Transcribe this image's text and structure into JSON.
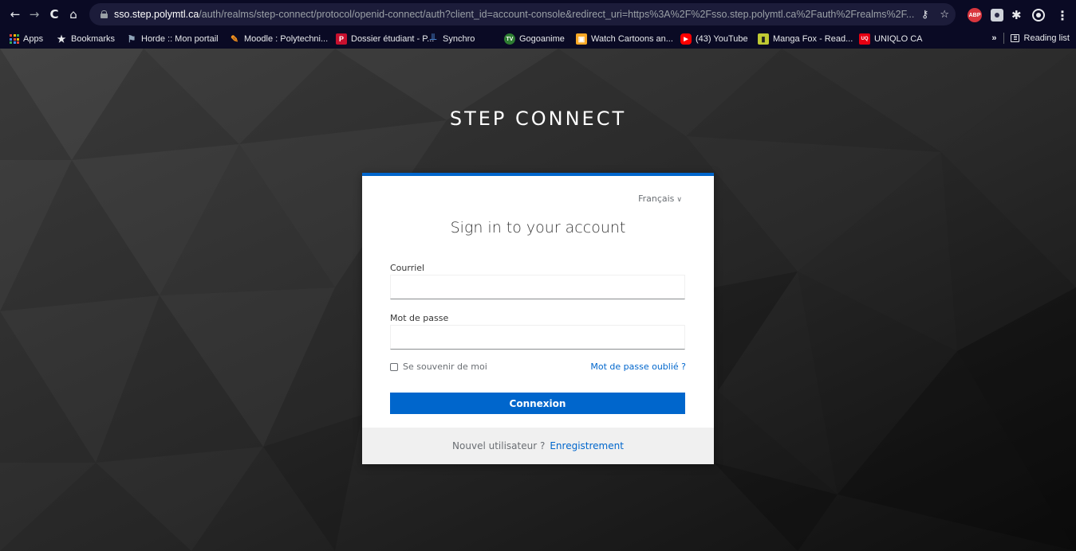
{
  "browser": {
    "url_host": "sso.step.polymtl.ca",
    "url_path": "/auth/realms/step-connect/protocol/openid-connect/auth?client_id=account-console&redirect_uri=https%3A%2F%2Fsso.step.polymtl.ca%2Fauth%2Frealms%2F...",
    "nav": {
      "back": "←",
      "forward": "→",
      "reload": "C",
      "home": "⌂"
    },
    "extensions": {
      "abp": "ABP"
    },
    "bookmarks": [
      {
        "label": "Apps",
        "icon": "apps-grid-icon"
      },
      {
        "label": "Bookmarks",
        "icon": "star-icon",
        "glyph": "★"
      },
      {
        "label": "Horde :: Mon portail",
        "icon": "horde-icon",
        "glyph": "⚑",
        "color": "#8fa3b8"
      },
      {
        "label": "Moodle : Polytechni...",
        "icon": "moodle-icon",
        "glyph": "✎",
        "color": "#f7931e"
      },
      {
        "label": "Dossier étudiant - P...",
        "icon": "polytechnique-icon",
        "glyph": "P",
        "color": "#c8102e"
      },
      {
        "label": "Synchro",
        "icon": "synchro-icon",
        "glyph": "╨",
        "color": "#1565c0"
      },
      {
        "label": "Gogoanime",
        "icon": "gogoanime-icon",
        "glyph": "TV",
        "color": "#2e7d32"
      },
      {
        "label": "Watch Cartoons an...",
        "icon": "cartoons-icon",
        "glyph": "▣",
        "color": "#f9a825"
      },
      {
        "label": "(43) YouTube",
        "icon": "youtube-icon",
        "glyph": "▶",
        "color": "#ff0000"
      },
      {
        "label": "Manga Fox - Read...",
        "icon": "mangafox-icon",
        "glyph": "▮",
        "color": "#c0ca33"
      },
      {
        "label": "UNIQLO CA",
        "icon": "uniqlo-icon",
        "glyph": "UQ",
        "color": "#e60012"
      }
    ],
    "more": "»",
    "reading_list": "Reading list"
  },
  "page": {
    "brand": "STEP CONNECT",
    "language": "Français",
    "language_caret": "∨",
    "heading": "Sign in to your account",
    "email_label": "Courriel",
    "email_value": "",
    "password_label": "Mot de passe",
    "password_value": "",
    "remember_label": "Se souvenir de moi",
    "forgot_label": "Mot de passe oublié ?",
    "submit_label": "Connexion",
    "new_user_text": "Nouvel utilisateur ?",
    "register_label": "Enregistrement"
  },
  "colors": {
    "chrome_bg": "#0a0a24",
    "accent": "#0066cc",
    "card_bg": "#ffffff",
    "footer_bg": "#f0f0f0"
  }
}
